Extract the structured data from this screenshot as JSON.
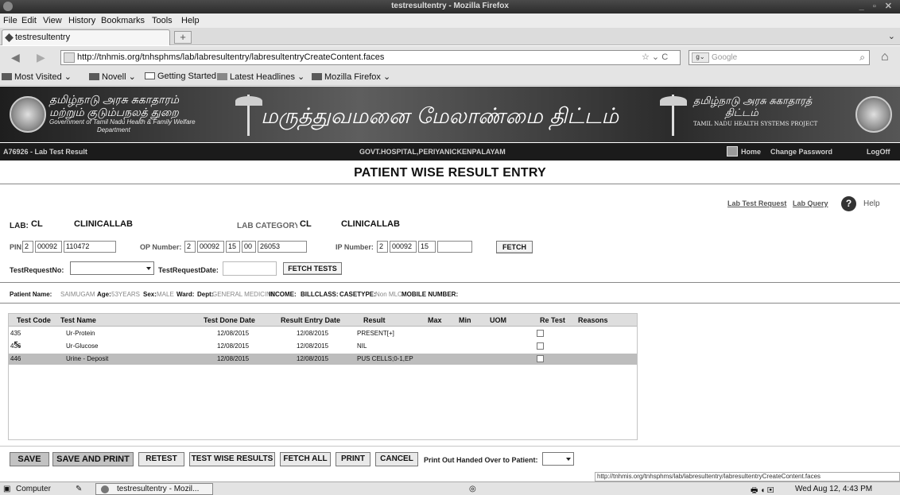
{
  "window": {
    "title": "testresultentry - Mozilla Firefox"
  },
  "menu": [
    "File",
    "Edit",
    "View",
    "History",
    "Bookmarks",
    "Tools",
    "Help"
  ],
  "tab": {
    "label": "testresultentry",
    "new_tab": "+"
  },
  "nav": {
    "url": "http://tnhmis.org/tnhsphms/lab/labresultentry/labresultentryCreateContent.faces",
    "search_placeholder": "Google"
  },
  "bookmarks": [
    "Most Visited",
    "Novell",
    "Getting Started",
    "Latest Headlines",
    "Mozilla Firefox"
  ],
  "banner": {
    "left_line1": "தமிழ்நாடு அரசு சுகாதாரம்",
    "left_line2": "மற்றும் குடும்பநலத் துறை",
    "left_sub1": "Government of Tamil Nadu Health & Family Welfare",
    "left_sub2": "Department",
    "middle": "மருத்துவமனை மேலாண்மை திட்டம்",
    "right_line1": "தமிழ்நாடு அரசு சுகாதாரத்",
    "right_line2": "திட்டம்",
    "right_sub": "TAMIL NADU HEALTH SYSTEMS PROJECT"
  },
  "infobar": {
    "left": "A76926 - Lab Test Result",
    "center": "GOVT.HOSPITAL,PERIYANICKENPALAYAM",
    "home": "Home",
    "change_password": "Change Password",
    "logoff": "LogOff"
  },
  "page_title": "PATIENT WISE RESULT ENTRY",
  "links": {
    "lab_test_request": "Lab Test Request",
    "lab_query": "Lab Query",
    "help": "Help"
  },
  "form": {
    "lab_label": "LAB:",
    "lab_code": "CL",
    "lab_name": "CLINICALLAB",
    "lab_category_label": "LAB CATEGORY:",
    "lab_category_code": "CL",
    "lab_category_name": "CLINICALLAB",
    "pin_label": "PIN:",
    "pin": [
      "2",
      "00092",
      "110472"
    ],
    "op_label": "OP Number:",
    "op": [
      "2",
      "00092",
      "15",
      "00",
      "26053"
    ],
    "ip_label": "IP Number:",
    "ip": [
      "2",
      "00092",
      "15",
      ""
    ],
    "fetch_label": "FETCH",
    "test_request_no_label": "TestRequestNo:",
    "test_request_date_label": "TestRequestDate:",
    "fetch_tests_label": "FETCH TESTS"
  },
  "patient": {
    "name_label": "Patient Name:",
    "name": "SAIMUGAM",
    "age_label": "Age:",
    "age": "53YEARS",
    "sex_label": "Sex:",
    "sex": "MALE",
    "ward_label": "Ward:",
    "dept_label": "Dept:",
    "dept": "GENERAL MEDICINE",
    "income_label": "INCOME:",
    "billclass_label": "BILLCLASS:",
    "casetype_label": "CASETYPE:",
    "casetype": "Non MLC",
    "mobile_label": "MOBILE NUMBER:"
  },
  "table": {
    "headers": [
      "Test Code",
      "Test Name",
      "Test Done Date",
      "Result Entry Date",
      "Result",
      "Max",
      "Min",
      "UOM",
      "Re Test",
      "Reasons"
    ],
    "rows": [
      [
        "435",
        "Ur-Protein",
        "12/08/2015",
        "12/08/2015",
        "PRESENT[+]"
      ],
      [
        "436",
        "Ur-Glucose",
        "12/08/2015",
        "12/08/2015",
        "NIL"
      ],
      [
        "446",
        "Urine - Deposit",
        "12/08/2015",
        "12/08/2015",
        "PUS CELLS;0-1,EP"
      ]
    ]
  },
  "buttons": {
    "save": "SAVE",
    "save_print": "SAVE AND PRINT",
    "retest": "RETEST",
    "test_wise": "TEST WISE RESULTS",
    "fetch_all": "FETCH ALL",
    "print": "PRINT",
    "cancel": "CANCEL",
    "handed_over_label": "Print Out Handed Over to Patient:"
  },
  "status": {
    "url": "http://tnhmis.org/tnhsphms/lab/labresultentry/labresultentryCreateContent.faces",
    "computer": "Computer",
    "task": "testresultentry - Mozil...",
    "clock": "Wed Aug 12,  4:43 PM"
  }
}
